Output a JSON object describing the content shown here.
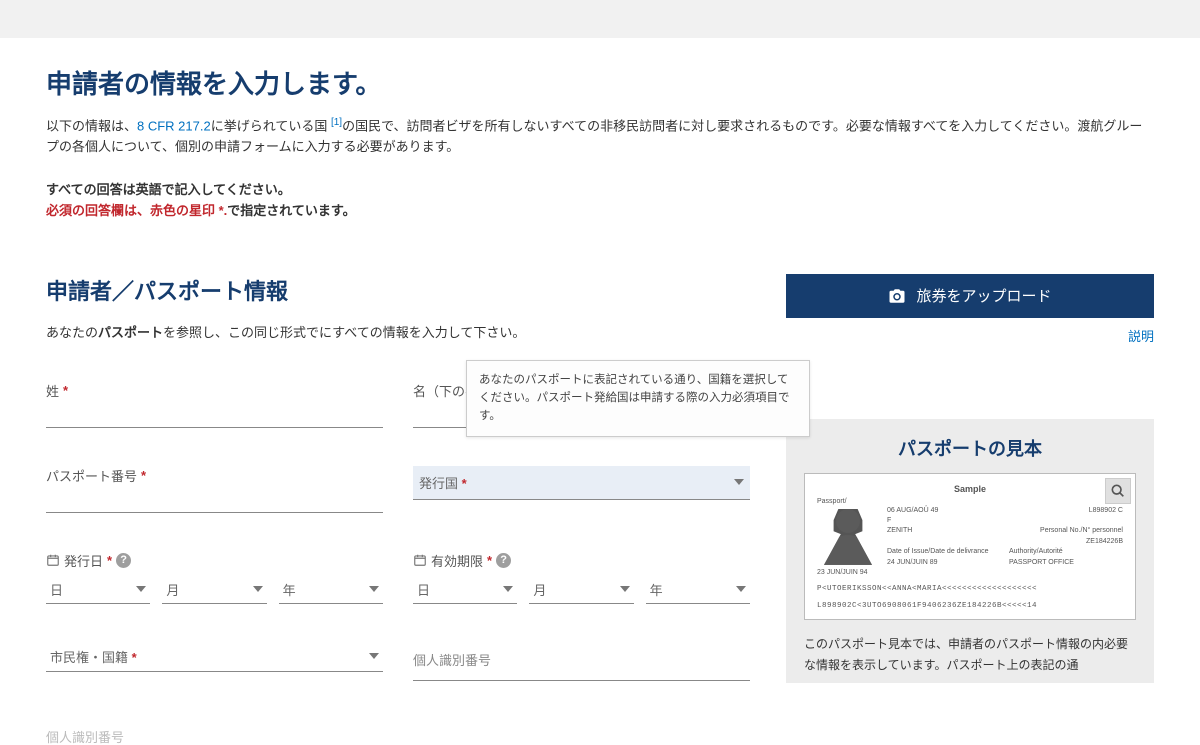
{
  "page": {
    "title": "申請者の情報を入力します。",
    "intro_prefix": "以下の情報は、",
    "intro_link": "8 CFR 217.2",
    "intro_sup": "[1]",
    "intro_rest": "に挙げられている国 ",
    "intro_after": "の国民で、訪問者ビザを所有しないすべての非移民訪問者に対し要求されるものです。必要な情報すべてを入力してください。渡航グループの各個人について、個別の申請フォームに入力する必要があります。",
    "instruct_line1": "すべての回答は英語で記入してください。",
    "instruct_line2_red": "必須の回答欄は、赤色の星印 *.",
    "instruct_line2_rest": "で指定されています。"
  },
  "section": {
    "title": "申請者／パスポート情報",
    "desc_before": "あなたの",
    "desc_bold": "パスポート",
    "desc_after": "を参照し、この同じ形式でにすべての情報を入力して下さい。"
  },
  "fields": {
    "surname": "姓",
    "givenname": "名（下の名前）",
    "passport_no": "パスポート番号",
    "issuing_country": "発行国",
    "issue_date": "発行日",
    "expiry_date": "有効期限",
    "day": "日",
    "month": "月",
    "year": "年",
    "nationality": "市民権・国籍",
    "personal_id": "個人識別番号",
    "personal_id2": "個人識別番号"
  },
  "tooltip": {
    "text": "あなたのパスポートに表記されている通り、国籍を選択してください。パスポート発給国は申請する際の入力必須項目です。"
  },
  "right": {
    "upload_label": "旅券をアップロード",
    "explain": "説明",
    "sample_title": "パスポートの見本",
    "sample_word": "Sample",
    "passport_label": "Passport/",
    "field_issue": "Date of Issue/Date de delivrance",
    "field_issue_val": "24 JUN/JUIN 89",
    "field_exp_val": "23 JUN/JUIN 94",
    "field_auth": "Authority/Autorité",
    "field_auth_val": "PASSPORT OFFICE",
    "field_pid": "Personal No./N° personnel",
    "field_pid_val": "ZE184226B",
    "field_dob_val": "06 AUG/AOÛ 49",
    "field_pno_val": "L898902 C",
    "mrz1": "P<UTOERIKSSON<<ANNA<MARIA<<<<<<<<<<<<<<<<<<<",
    "mrz2": "L898902C<3UTO6908061F9406236ZE184226B<<<<<14",
    "sample_desc": "このパスポート見本では、申請者のパスポート情報の内必要な情報を表示しています。パスポート上の表記の通"
  }
}
